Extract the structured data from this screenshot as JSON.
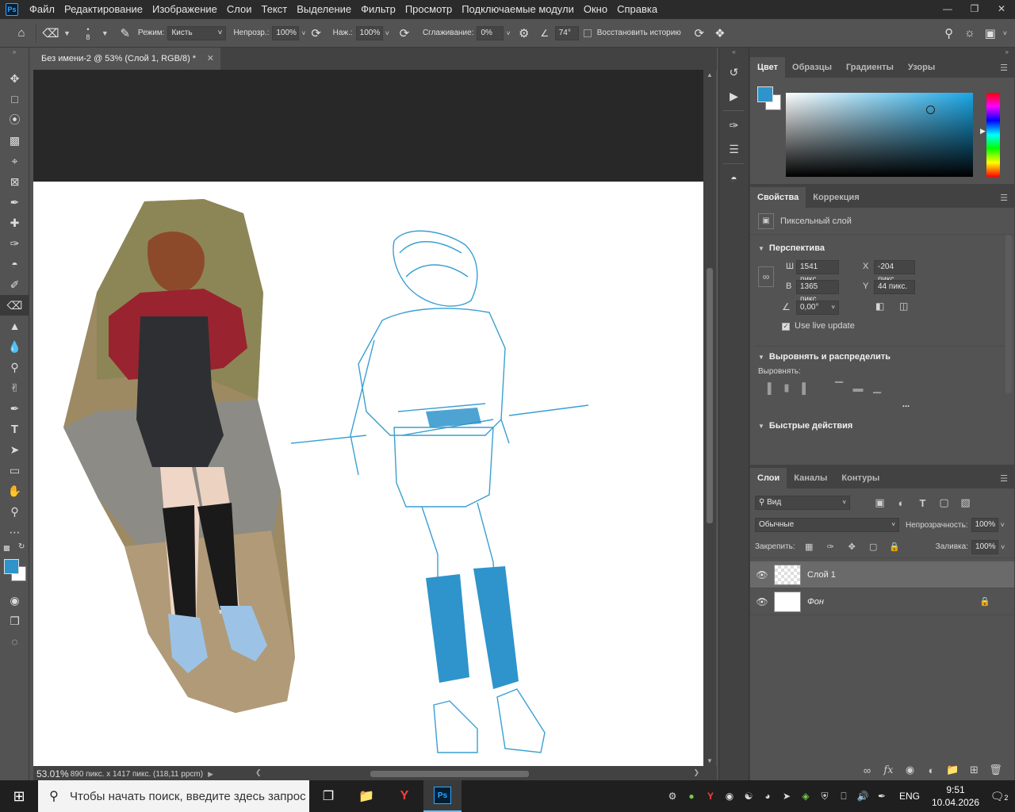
{
  "app": {
    "logo": "Ps"
  },
  "menu": [
    "Файл",
    "Редактирование",
    "Изображение",
    "Слои",
    "Текст",
    "Выделение",
    "Фильтр",
    "Просмотр",
    "Подключаемые модули",
    "Окно",
    "Справка"
  ],
  "options": {
    "brush_size": "8",
    "mode_label": "Режим:",
    "mode_value": "Кисть",
    "opacity_label": "Непрозр.:",
    "opacity_value": "100%",
    "pressure_label": "Наж.:",
    "pressure_value": "100%",
    "smoothing_label": "Сглаживание:",
    "smoothing_value": "0%",
    "angle_value": "74°",
    "restore_history_label": "Восстановить историю"
  },
  "document": {
    "tab_title": "Без имени-2 @ 53% (Слой 1, RGB/8) *",
    "zoom": "53.01%",
    "info": "890 пикс. x 1417 пикс. (118,11 ppcm)"
  },
  "color_panel": {
    "tabs": [
      "Цвет",
      "Образцы",
      "Градиенты",
      "Узоры"
    ],
    "foreground": "#2e94cb",
    "background": "#ffffff"
  },
  "properties_panel": {
    "tabs": [
      "Свойства",
      "Коррекция"
    ],
    "layer_kind": "Пиксельный слой",
    "transform_section": "Перспектива",
    "w_label": "Ш",
    "w_value": "1541 пикс",
    "h_label": "В",
    "h_value": "1365 пикс",
    "x_label": "X",
    "x_value": "-204 пикс",
    "y_label": "Y",
    "y_value": "44 пикс.",
    "angle_value": "0,00°",
    "live_update_label": "Use live update",
    "align_section": "Выровнять и распределить",
    "align_sub": "Выровнять:",
    "more": "...",
    "quick_actions": "Быстрые действия"
  },
  "layers_panel": {
    "tabs": [
      "Слои",
      "Каналы",
      "Контуры"
    ],
    "filter_value": "Вид",
    "blend_mode": "Обычные",
    "opacity_label": "Непрозрачность:",
    "opacity_value": "100%",
    "lock_label": "Закрепить:",
    "fill_label": "Заливка:",
    "fill_value": "100%",
    "layers": [
      {
        "name": "Слой 1",
        "selected": true
      },
      {
        "name": "Фон",
        "selected": false
      }
    ]
  },
  "taskbar": {
    "search_placeholder": "Чтобы начать поиск, введите здесь запрос",
    "lang": "ENG",
    "time": "9:51",
    "date": "10.04.2026",
    "notifications": "2"
  }
}
